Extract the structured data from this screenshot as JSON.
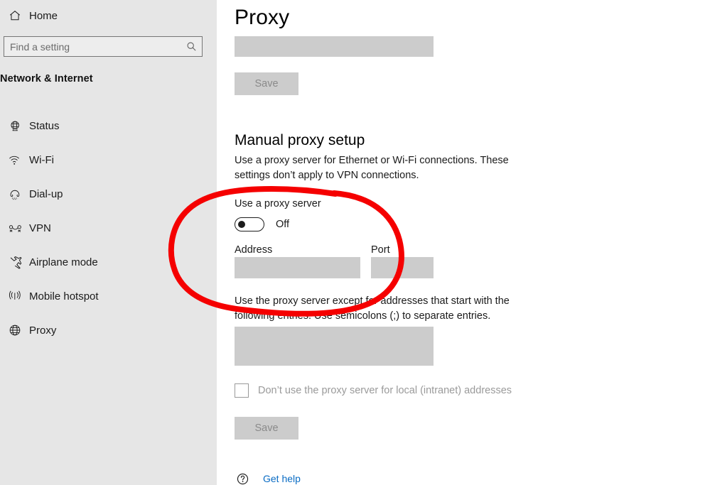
{
  "sidebar": {
    "home": {
      "label": "Home",
      "icon": "home-icon"
    },
    "search": {
      "value": "",
      "placeholder": "Find a setting",
      "icon": "search-icon"
    },
    "category_title": "Network & Internet",
    "items": [
      {
        "label": "Status",
        "icon": "globe-status-icon"
      },
      {
        "label": "Wi-Fi",
        "icon": "wifi-icon"
      },
      {
        "label": "Dial-up",
        "icon": "dialup-icon"
      },
      {
        "label": "VPN",
        "icon": "vpn-icon"
      },
      {
        "label": "Airplane mode",
        "icon": "airplane-icon"
      },
      {
        "label": "Mobile hotspot",
        "icon": "hotspot-icon"
      },
      {
        "label": "Proxy",
        "icon": "globe-icon"
      }
    ]
  },
  "main": {
    "page_title": "Proxy",
    "auto_setup": {
      "script_address_value": "",
      "save_label": "Save"
    },
    "manual_setup": {
      "heading": "Manual proxy setup",
      "description": "Use a proxy server for Ethernet or Wi-Fi connections. These settings don’t apply to VPN connections.",
      "toggle_label": "Use a proxy server",
      "toggle_state": "Off",
      "address_label": "Address",
      "address_value": "",
      "port_label": "Port",
      "port_value": "",
      "exceptions_description": "Use the proxy server except for addresses that start with the following entries. Use semicolons (;) to separate entries.",
      "exceptions_value": "",
      "bypass_local_label": "Don’t use the proxy server for local (intranet) addresses",
      "bypass_local_checked": false,
      "save_label": "Save"
    },
    "get_help": {
      "label": "Get help",
      "icon": "help-icon"
    }
  },
  "annotation": {
    "shape": "hand-drawn-ellipse",
    "color": "#f50000",
    "stroke_width": 8,
    "targets": [
      "Use a proxy server toggle",
      "Address field",
      "Port field"
    ]
  },
  "colors": {
    "sidebar_bg": "#e6e6e6",
    "content_bg": "#ffffff",
    "disabled_field": "#cccccc",
    "disabled_text": "#8a8a8a",
    "link": "#0a6cc4",
    "annotation_red": "#f50000"
  }
}
